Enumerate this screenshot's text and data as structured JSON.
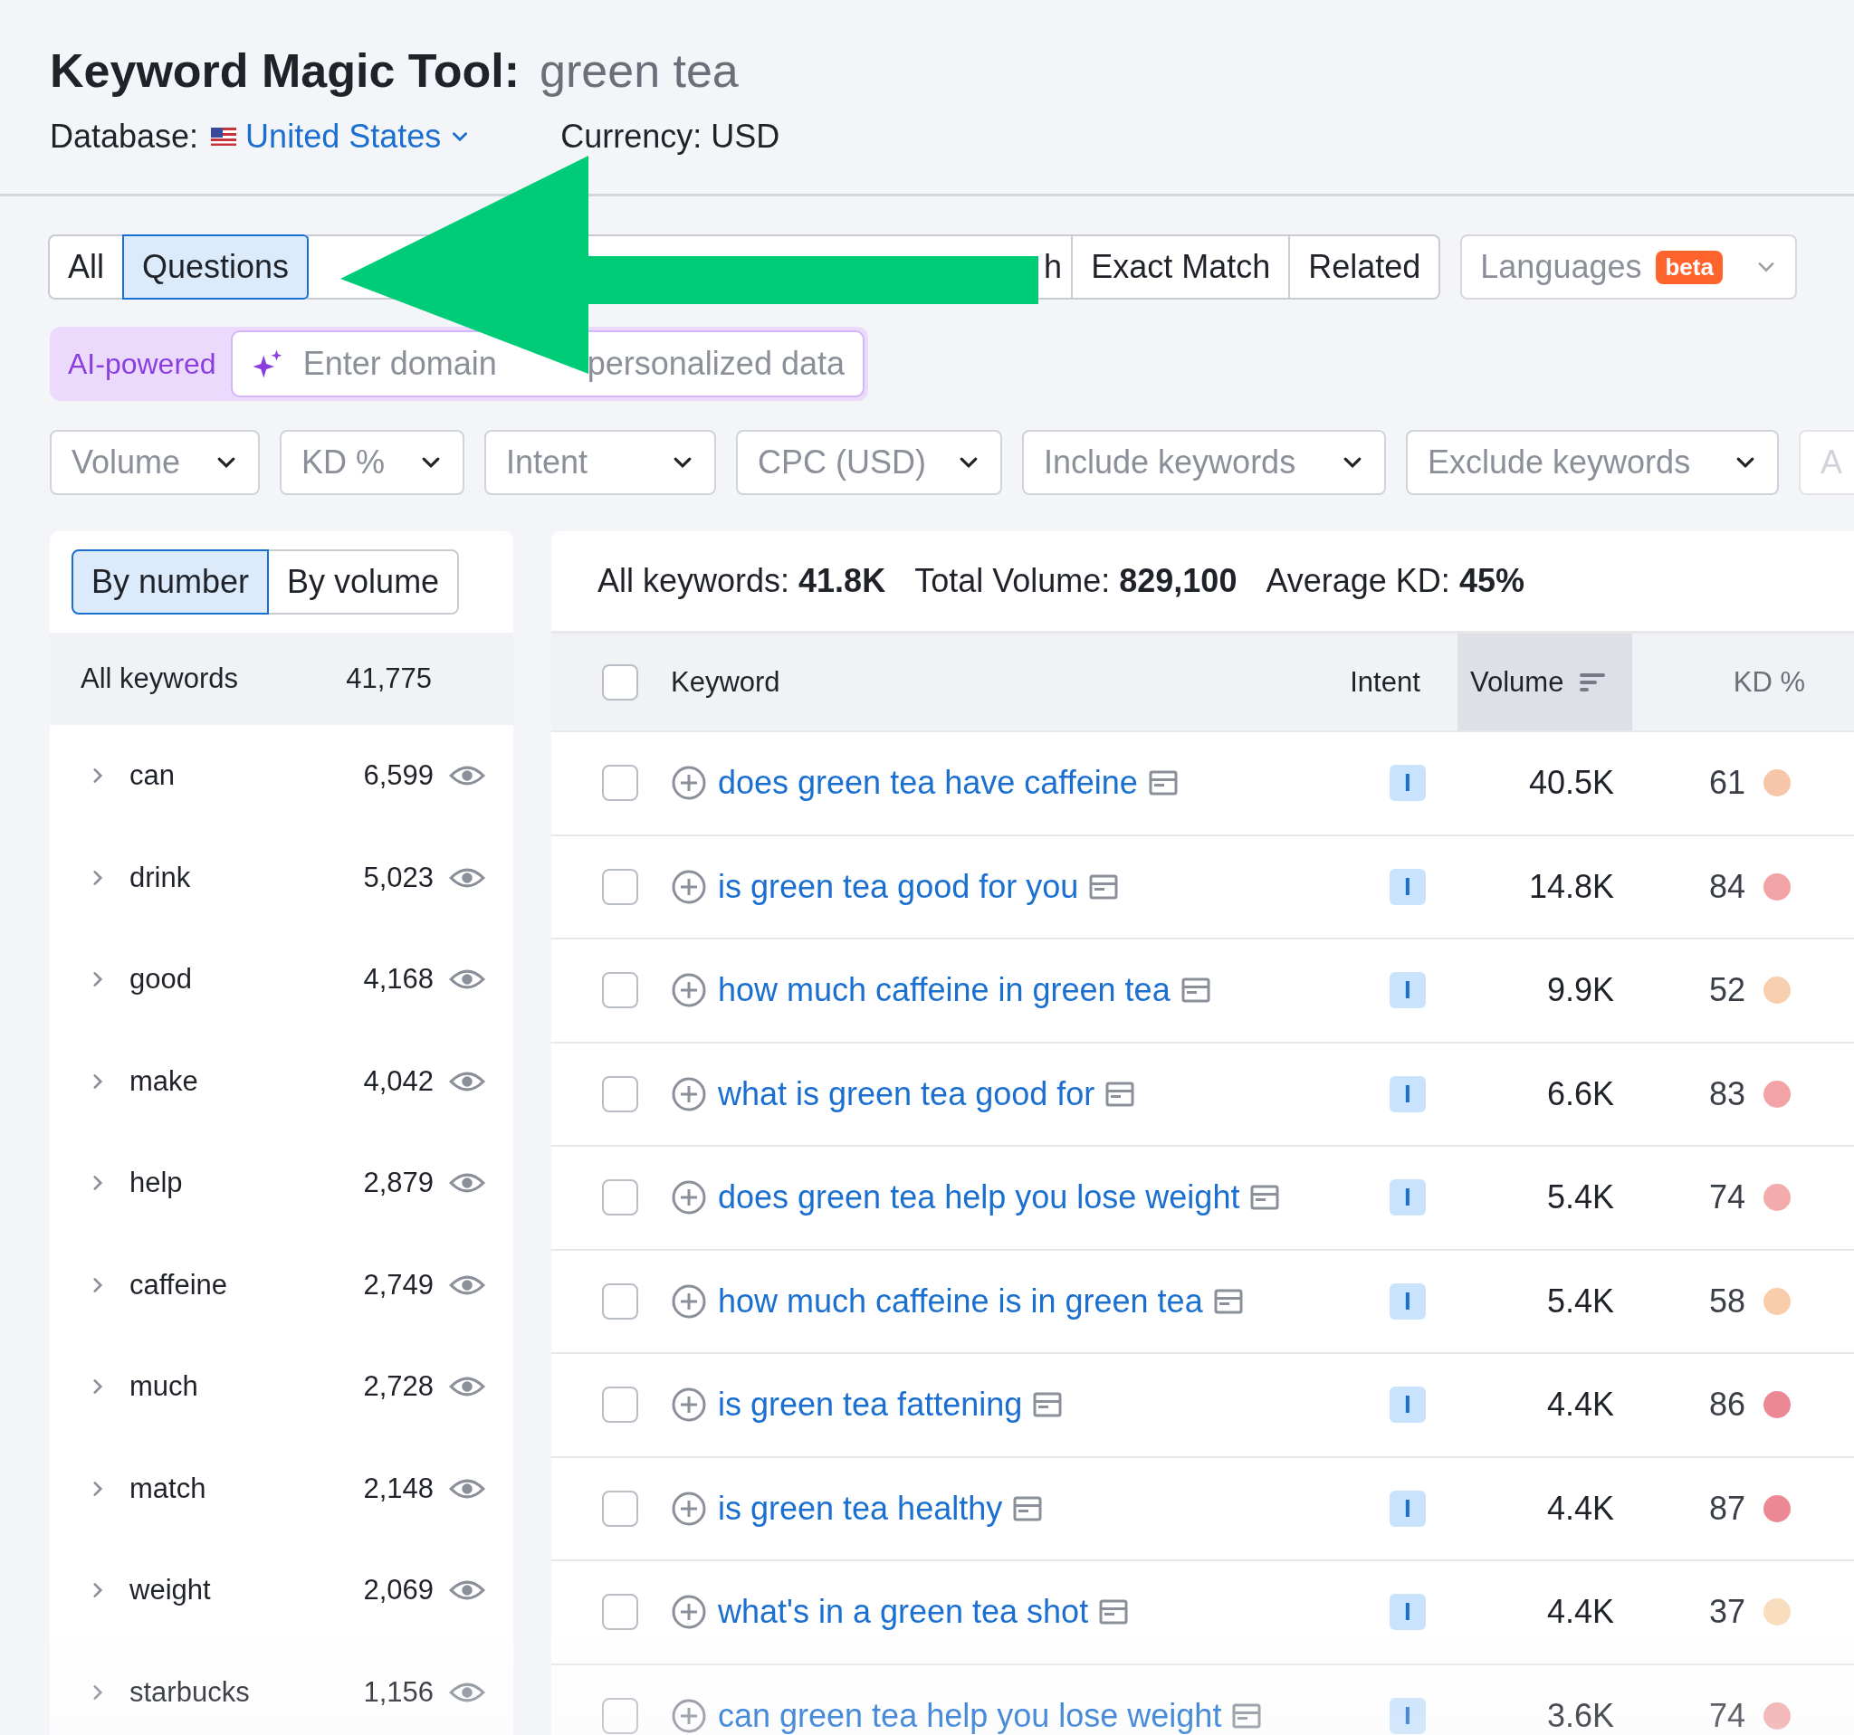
{
  "header": {
    "title": "Keyword Magic Tool:",
    "query": "green tea",
    "database_label": "Database:",
    "database": "United States",
    "currency": "Currency: USD"
  },
  "tabs": [
    {
      "label": "All",
      "selected": false
    },
    {
      "label": "Questions",
      "selected": true
    },
    {
      "label": "h",
      "selected": false,
      "covered": true
    },
    {
      "label": "Exact Match",
      "selected": false
    },
    {
      "label": "Related",
      "selected": false
    }
  ],
  "languages": {
    "label": "Languages",
    "badge": "beta"
  },
  "ai": {
    "label": "AI-powered",
    "placeholder_parts": [
      "Enter domain ",
      "personalized data"
    ]
  },
  "filters": [
    "Volume",
    "KD %",
    "Intent",
    "CPC (USD)",
    "Include keywords",
    "Exclude keywords",
    "A"
  ],
  "groups": {
    "toggle": [
      {
        "label": "By number",
        "selected": true
      },
      {
        "label": "By volume",
        "selected": false
      }
    ],
    "all": {
      "label": "All keywords",
      "count": "41,775"
    },
    "items": [
      {
        "word": "can",
        "count": "6,599"
      },
      {
        "word": "drink",
        "count": "5,023"
      },
      {
        "word": "good",
        "count": "4,168"
      },
      {
        "word": "make",
        "count": "4,042"
      },
      {
        "word": "help",
        "count": "2,879"
      },
      {
        "word": "caffeine",
        "count": "2,749"
      },
      {
        "word": "much",
        "count": "2,728"
      },
      {
        "word": "match",
        "count": "2,148"
      },
      {
        "word": "weight",
        "count": "2,069"
      },
      {
        "word": "starbucks",
        "count": "1,156"
      }
    ]
  },
  "summary": [
    {
      "label": "All keywords:",
      "value": "41.8K"
    },
    {
      "label": "Total Volume:",
      "value": "829,100"
    },
    {
      "label": "Average KD:",
      "value": "45%"
    }
  ],
  "table": {
    "select_all_checked": false,
    "columns": [
      "Keyword",
      "Intent",
      "Volume",
      "KD %"
    ],
    "rows": [
      {
        "keyword": "does green tea have caffeine",
        "intent": "I",
        "volume": "40.5K",
        "kd": "61",
        "color": "#f7c6a8",
        "checked": false
      },
      {
        "keyword": "is green tea good for you",
        "intent": "I",
        "volume": "14.8K",
        "kd": "84",
        "color": "#f2a3a6",
        "checked": false
      },
      {
        "keyword": "how much caffeine in green tea",
        "intent": "I",
        "volume": "9.9K",
        "kd": "52",
        "color": "#f8cfae",
        "checked": false
      },
      {
        "keyword": "what is green tea good for",
        "intent": "I",
        "volume": "6.6K",
        "kd": "83",
        "color": "#f2a3a6",
        "checked": false
      },
      {
        "keyword": "does green tea help you lose weight",
        "intent": "I",
        "volume": "5.4K",
        "kd": "74",
        "color": "#f3abab",
        "checked": false
      },
      {
        "keyword": "how much caffeine is in green tea",
        "intent": "I",
        "volume": "5.4K",
        "kd": "58",
        "color": "#f8cdac",
        "checked": false
      },
      {
        "keyword": "is green tea fattening",
        "intent": "I",
        "volume": "4.4K",
        "kd": "86",
        "color": "#ec8894",
        "checked": false
      },
      {
        "keyword": "is green tea healthy",
        "intent": "I",
        "volume": "4.4K",
        "kd": "87",
        "color": "#ec8894",
        "checked": false
      },
      {
        "keyword": "what's in a green tea shot",
        "intent": "I",
        "volume": "4.4K",
        "kd": "37",
        "color": "#f8ddbe",
        "checked": false
      },
      {
        "keyword": "can green tea help you lose weight",
        "intent": "I",
        "volume": "3.6K",
        "kd": "74",
        "color": "#f3abab",
        "checked": false
      }
    ]
  }
}
